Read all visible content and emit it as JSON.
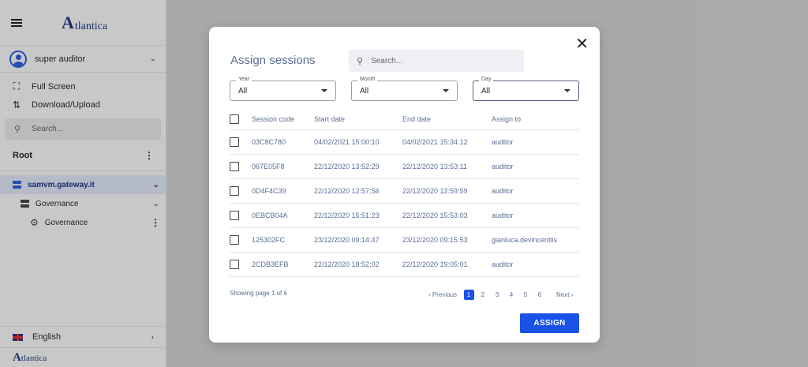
{
  "sidebar": {
    "logo_text": "tlantica",
    "logo_letter": "A",
    "user_name": "super auditor",
    "actions": [
      {
        "label": "Full Screen",
        "icon": "fullscreen-icon"
      },
      {
        "label": "Download/Upload",
        "icon": "download-upload-icon"
      }
    ],
    "search_placeholder": "Search...",
    "root_label": "Root",
    "tree": [
      {
        "label": "samvm.gateway.it"
      },
      {
        "label": "Governance"
      },
      {
        "label": "Governance"
      }
    ],
    "language": "English",
    "footer_logo_letter": "A",
    "footer_logo_text": "tlantica"
  },
  "modal": {
    "title": "Assign sessions",
    "search_placeholder": "Search...",
    "filters": [
      {
        "label": "Year",
        "value": "All"
      },
      {
        "label": "Month",
        "value": "All"
      },
      {
        "label": "Day",
        "value": "All"
      }
    ],
    "columns": [
      "Session code",
      "Start date",
      "End date",
      "Assign to"
    ],
    "rows": [
      {
        "code": "03C8C780",
        "start": "04/02/2021 15:00:10",
        "end": "04/02/2021 15:34:12",
        "to": "auditor"
      },
      {
        "code": "067E05F8",
        "start": "22/12/2020 13:52:29",
        "end": "22/12/2020 13:53:11",
        "to": "auditor"
      },
      {
        "code": "0D4F4C39",
        "start": "22/12/2020 12:57:56",
        "end": "22/12/2020 12:59:59",
        "to": "auditor"
      },
      {
        "code": "0EBCB04A",
        "start": "22/12/2020 15:51:23",
        "end": "22/12/2020 15:53:03",
        "to": "auditor"
      },
      {
        "code": "125302FC",
        "start": "23/12/2020 09:14:47",
        "end": "23/12/2020 09:15:53",
        "to": "gianluca.devincentiis"
      },
      {
        "code": "2CDB3EFB",
        "start": "22/12/2020 18:52:02",
        "end": "22/12/2020 19:05:01",
        "to": "auditor"
      }
    ],
    "showing": "Showing page 1 of 6",
    "pagination": {
      "previous": "Previous",
      "next": "Next",
      "pages": [
        "1",
        "2",
        "3",
        "4",
        "5",
        "6"
      ],
      "current": "1"
    },
    "assign_label": "ASSIGN",
    "colors": {
      "accent": "#1a52e8",
      "muted_text": "#5a6e96"
    }
  }
}
